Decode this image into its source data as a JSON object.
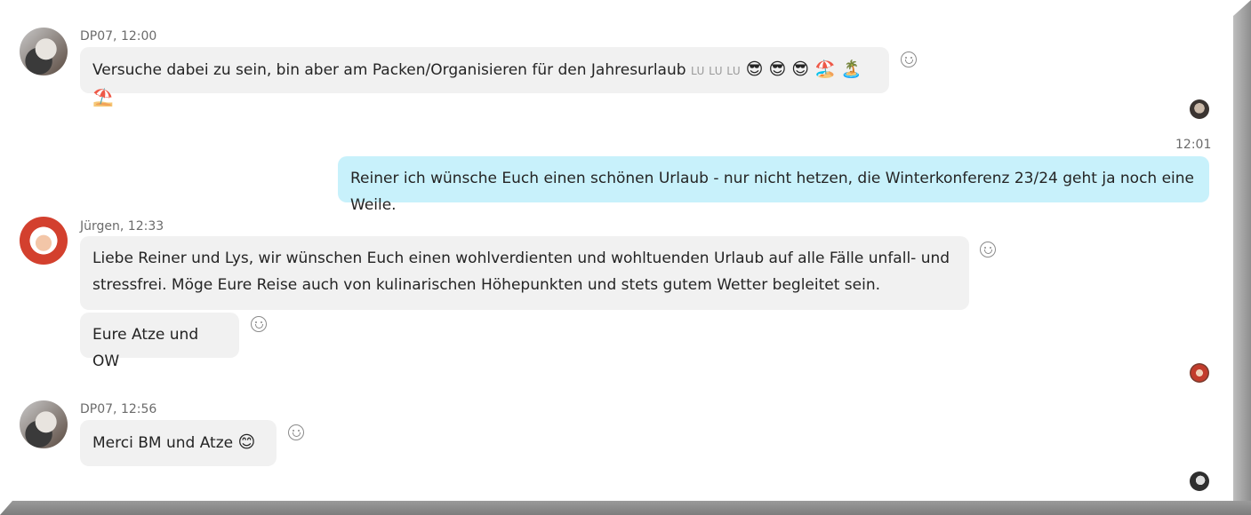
{
  "messages": [
    {
      "sender": "DP07",
      "meta": "DP07, 12:00",
      "text": "Versuche dabei zu sein, bin aber am Packen/Organisieren für den Jahresurlaub",
      "suffix_small": "LU LU LU",
      "emojis": "😎 😎 😎 🏖️ 🏝️ ⛱️"
    },
    {
      "sender": "self",
      "meta": "12:01",
      "text": "Reiner ich wünsche Euch einen schönen Urlaub - nur nicht hetzen, die Winterkonferenz 23/24 geht ja noch eine Weile."
    },
    {
      "sender": "Jürgen",
      "meta": "Jürgen, 12:33",
      "text": "Liebe Reiner und Lys, wir wünschen Euch einen wohlverdienten und wohltuenden Urlaub auf alle Fälle unfall- und stressfrei. Möge Eure Reise auch von kulinarischen Höhepunkten und stets gutem Wetter begleitet sein.",
      "text2": "Eure Atze und OW"
    },
    {
      "sender": "DP07",
      "meta": "DP07, 12:56",
      "text": "Merci BM und Atze",
      "emojis": "😊"
    }
  ]
}
